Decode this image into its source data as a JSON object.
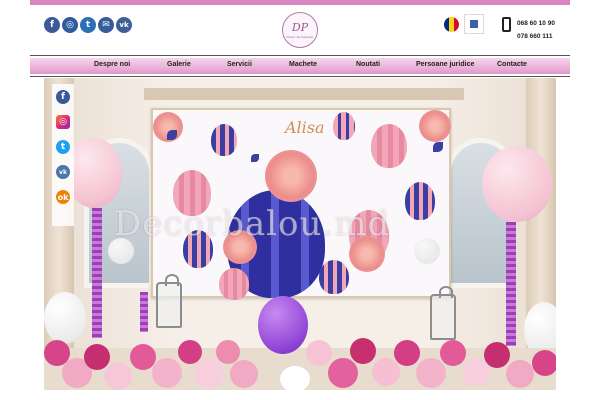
{
  "header": {
    "socials": [
      {
        "icon": "facebook-icon",
        "glyph": "f"
      },
      {
        "icon": "instagram-icon",
        "glyph": "◎"
      },
      {
        "icon": "twitter-icon",
        "glyph": "t"
      },
      {
        "icon": "mail-icon",
        "glyph": "✉"
      },
      {
        "icon": "vk-icon",
        "glyph": "vk"
      }
    ],
    "logo": {
      "mark": "DP",
      "subtitle": "Decor de baloane"
    },
    "flag_colors": [
      "#002b7f",
      "#fcd116",
      "#ce1126"
    ],
    "phones": [
      "068 60 10 90",
      "078 660 111"
    ]
  },
  "nav": {
    "items": [
      "Despre noi",
      "Galerie",
      "Servicii",
      "Machete",
      "Noutati",
      "Persoane juridice",
      "Contacte"
    ]
  },
  "side_social": {
    "items": [
      {
        "icon": "facebook-icon",
        "glyph": "f"
      },
      {
        "icon": "instagram-icon",
        "glyph": "◎"
      },
      {
        "icon": "twitter-icon",
        "glyph": "t"
      },
      {
        "icon": "vk-icon",
        "glyph": "vk"
      },
      {
        "icon": "odnoklassniki-icon",
        "glyph": "ok"
      }
    ]
  },
  "hero": {
    "backdrop_title": "Alisa",
    "watermark": "Decorbalou.md"
  },
  "colors": {
    "accent": "#d985c2",
    "nav_pink": "#eab1d9",
    "social_blue": "#3b5a99"
  }
}
